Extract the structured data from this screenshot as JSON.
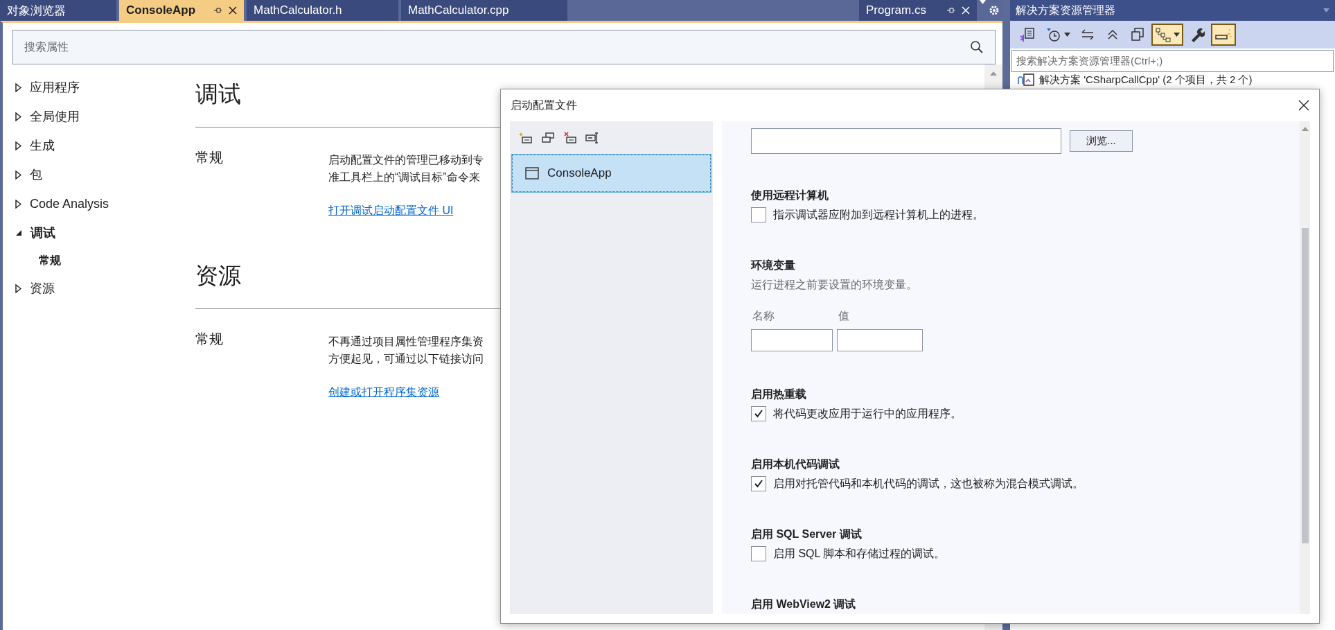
{
  "document_tabs": [
    {
      "label": "对象浏览器",
      "selected": false,
      "actions": false
    },
    {
      "label": "ConsoleApp",
      "selected": true,
      "actions": true
    },
    {
      "label": "MathCalculator.h",
      "selected": false,
      "actions": false
    },
    {
      "label": "MathCalculator.cpp",
      "selected": false,
      "actions": false
    },
    {
      "label": "Program.cs",
      "selected": false,
      "actions": true
    }
  ],
  "search": {
    "placeholder": "搜索属性"
  },
  "nav": [
    {
      "label": "应用程序",
      "expanded": false
    },
    {
      "label": "全局使用",
      "expanded": false
    },
    {
      "label": "生成",
      "expanded": false
    },
    {
      "label": "包",
      "expanded": false
    },
    {
      "label": "Code Analysis",
      "expanded": false
    },
    {
      "label": "调试",
      "expanded": true,
      "children": [
        {
          "label": "常规",
          "selected": true
        }
      ]
    },
    {
      "label": "资源",
      "expanded": false
    }
  ],
  "sections": [
    {
      "title": "调试",
      "groups": [
        {
          "label": "常规",
          "lines": [
            "启动配置文件的管理已移动到专",
            "准工具栏上的“调试目标”命令来"
          ],
          "link": "打开调试启动配置文件 UI"
        }
      ]
    },
    {
      "title": "资源",
      "groups": [
        {
          "label": "常规",
          "lines": [
            "不再通过项目属性管理程序集资",
            "方便起见，可通过以下链接访问"
          ],
          "link": "创建或打开程序集资源"
        }
      ]
    }
  ],
  "solution_explorer": {
    "title": "解决方案资源管理器",
    "toolbar": [
      {
        "selected": false,
        "dropdown": false
      },
      {
        "selected": false,
        "dropdown": true
      },
      {
        "selected": false,
        "dropdown": false
      },
      {
        "selected": false,
        "dropdown": false
      },
      {
        "selected": false,
        "dropdown": false
      },
      {
        "selected": true,
        "dropdown": true
      },
      {
        "selected": false,
        "dropdown": false
      },
      {
        "selected": true,
        "dropdown": false
      }
    ],
    "search": {
      "placeholder": "搜索解决方案资源管理器(Ctrl+;)"
    },
    "tree_item": "解决方案 'CSharpCallCpp' (2 个项目，共 2 个)"
  },
  "dialog": {
    "title": "启动配置文件",
    "profiles": [
      {
        "label": "ConsoleApp",
        "selected": true
      }
    ],
    "browse_button": "浏览...",
    "options": [
      {
        "kind": "checkbox",
        "heading": "使用远程计算机",
        "label": "指示调试器应附加到远程计算机上的进程。",
        "checked": false
      },
      {
        "kind": "env",
        "heading": "环境变量",
        "description": "运行进程之前要设置的环境变量。",
        "columns": [
          "名称",
          "值"
        ]
      },
      {
        "kind": "checkbox",
        "heading": "启用热重载",
        "label": "将代码更改应用于运行中的应用程序。",
        "checked": true
      },
      {
        "kind": "checkbox",
        "heading": "启用本机代码调试",
        "label": "启用对托管代码和本机代码的调试，这也被称为混合模式调试。",
        "checked": true
      },
      {
        "kind": "checkbox",
        "heading": "启用 SQL Server 调试",
        "label": "启用 SQL 脚本和存储过程的调试。",
        "checked": false
      },
      {
        "kind": "heading",
        "heading": "启用 WebView2 调试"
      }
    ]
  }
}
